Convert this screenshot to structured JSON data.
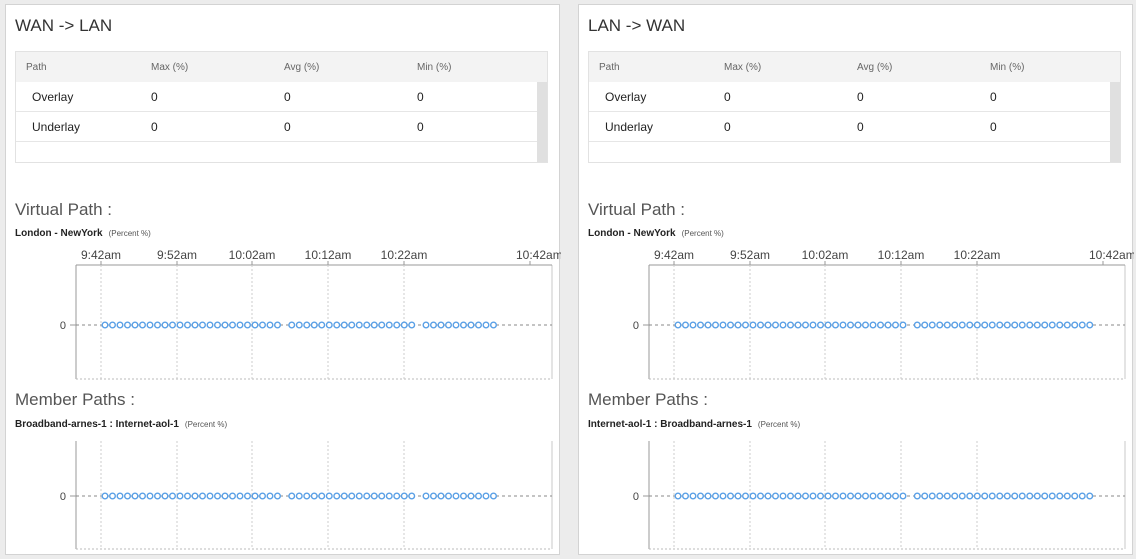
{
  "panels": [
    {
      "title": "WAN -> LAN",
      "table": {
        "headers": [
          "Path",
          "Max (%)",
          "Avg (%)",
          "Min (%)"
        ],
        "rows": [
          [
            "Overlay",
            "0",
            "0",
            "0"
          ],
          [
            "Underlay",
            "0",
            "0",
            "0"
          ]
        ]
      },
      "virtual_path": {
        "heading": "Virtual Path :",
        "name": "London - NewYork",
        "unit": "(Percent %)"
      },
      "member_paths": {
        "heading": "Member Paths :",
        "name": "Broadband-arnes-1 : Internet-aol-1",
        "unit": "(Percent %)"
      }
    },
    {
      "title": "LAN -> WAN",
      "table": {
        "headers": [
          "Path",
          "Max (%)",
          "Avg (%)",
          "Min (%)"
        ],
        "rows": [
          [
            "Overlay",
            "0",
            "0",
            "0"
          ],
          [
            "Underlay",
            "0",
            "0",
            "0"
          ]
        ]
      },
      "virtual_path": {
        "heading": "Virtual Path :",
        "name": "London - NewYork",
        "unit": "(Percent %)"
      },
      "member_paths": {
        "heading": "Member Paths :",
        "name": "Internet-aol-1 : Broadband-arnes-1",
        "unit": "(Percent %)"
      }
    }
  ],
  "chart_data": [
    {
      "type": "scatter",
      "panel": "WAN -> LAN",
      "series": "London - NewYork",
      "x_ticks": [
        "9:42am",
        "9:52am",
        "10:02am",
        "10:12am",
        "10:22am",
        "10:42am"
      ],
      "y_ticks": [
        "0"
      ],
      "points_y": 0,
      "point_groups": [
        24,
        17,
        10
      ],
      "point_color": "#5aa0e6"
    },
    {
      "type": "scatter",
      "panel": "WAN -> LAN",
      "series": "Broadband-arnes-1 : Internet-aol-1",
      "x_ticks": [],
      "y_ticks": [
        "0"
      ],
      "points_y": 0,
      "point_groups": [
        24,
        17,
        10
      ],
      "point_color": "#5aa0e6"
    },
    {
      "type": "scatter",
      "panel": "LAN -> WAN",
      "series": "London - NewYork",
      "x_ticks": [
        "9:42am",
        "9:52am",
        "10:02am",
        "10:12am",
        "10:22am",
        "10:42am"
      ],
      "y_ticks": [
        "0"
      ],
      "points_y": 0,
      "point_groups": [
        31,
        24
      ],
      "point_color": "#5aa0e6"
    },
    {
      "type": "scatter",
      "panel": "LAN -> WAN",
      "series": "Internet-aol-1 : Broadband-arnes-1",
      "x_ticks": [],
      "y_ticks": [
        "0"
      ],
      "points_y": 0,
      "point_groups": [
        31,
        24
      ],
      "point_color": "#5aa0e6"
    }
  ]
}
